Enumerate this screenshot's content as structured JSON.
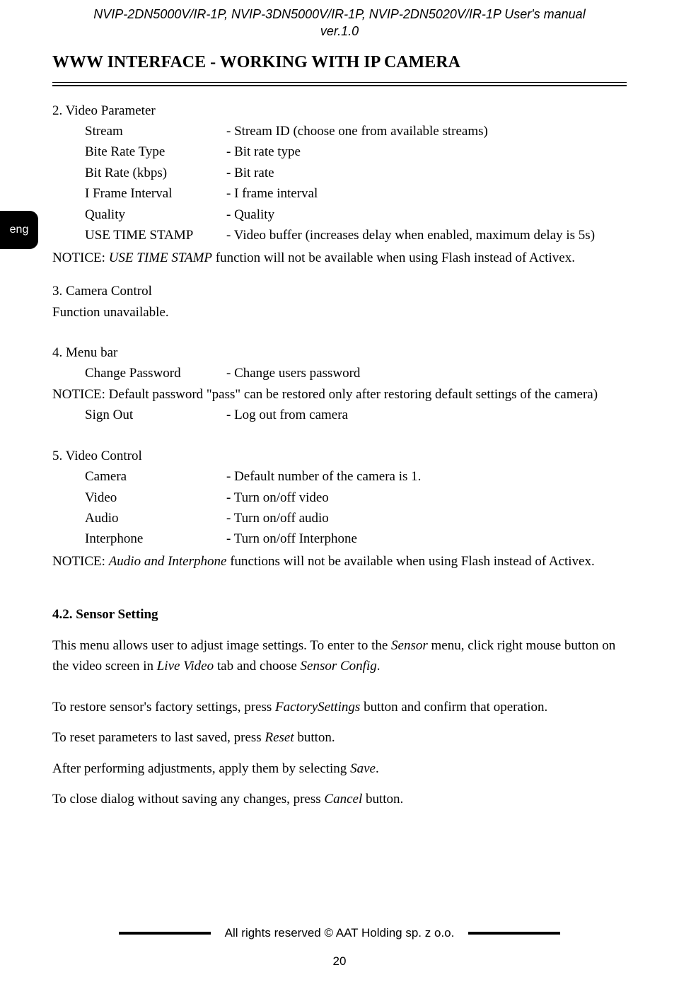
{
  "header": {
    "line1": "NVIP-2DN5000V/IR-1P, NVIP-3DN5000V/IR-1P, NVIP-2DN5020V/IR-1P User's manual",
    "line2": "ver.1.0"
  },
  "section_title": "WWW INTERFACE - WORKING WITH IP CAMERA",
  "lang_tab": "eng",
  "s2": {
    "heading": "2. Video Parameter",
    "rows": [
      {
        "term": "Stream",
        "desc": "- Stream ID (choose one from available streams)"
      },
      {
        "term": "Bite Rate Type",
        "desc": "- Bit rate type"
      },
      {
        "term": "Bit Rate (kbps)",
        "desc": "- Bit rate"
      },
      {
        "term": "I Frame Interval",
        "desc": "- I frame interval"
      },
      {
        "term": "Quality",
        "desc": "- Quality"
      },
      {
        "term": "USE TIME STAMP",
        "desc": "- Video buffer (increases delay when enabled, maximum delay is 5s)"
      }
    ],
    "notice_pre": "NOTICE: ",
    "notice_em": "USE TIME STAMP",
    "notice_post": " function will not be available when using Flash instead of Activex."
  },
  "s3": {
    "heading": "3. Camera Control",
    "text": "Function unavailable."
  },
  "s4": {
    "heading": "4. Menu bar",
    "row1": {
      "term": "Change Password",
      "desc": "- Change users password"
    },
    "notice": "NOTICE: Default password \"pass\" can be restored only after restoring default settings of the camera)",
    "row2": {
      "term": "Sign Out",
      "desc": "- Log out from camera"
    }
  },
  "s5": {
    "heading": "5. Video Control",
    "rows": [
      {
        "term": "Camera",
        "desc": "- Default number of the camera is 1."
      },
      {
        "term": "Video",
        "desc": "- Turn on/off video"
      },
      {
        "term": "Audio",
        "desc": "- Turn on/off audio"
      },
      {
        "term": "Interphone",
        "desc": "- Turn on/off Interphone"
      }
    ],
    "notice_pre": "NOTICE: ",
    "notice_em": "Audio and Interphone",
    "notice_post": " functions will not be available when using Flash instead of Activex."
  },
  "sec42": {
    "title": "4.2. Sensor Setting",
    "p1_a": "This menu allows user to adjust image settings. To enter to the ",
    "p1_em1": "Sensor",
    "p1_b": " menu, click right mouse button on the video screen in ",
    "p1_em2": "Live Video",
    "p1_c": " tab and choose ",
    "p1_em3": "Sensor Config",
    "p1_d": ".",
    "p2_a": "To restore sensor's factory settings, press ",
    "p2_em": "FactorySettings",
    "p2_b": " button and confirm that operation.",
    "p3_a": "To reset parameters to last saved, press ",
    "p3_em": "Reset",
    "p3_b": " button.",
    "p4_a": "After performing adjustments, apply them by selecting ",
    "p4_em": "Save",
    "p4_b": ".",
    "p5_a": "To close dialog without saving any changes, press ",
    "p5_em": "Cancel",
    "p5_b": " button."
  },
  "footer": "All rights reserved © AAT Holding sp. z o.o.",
  "page_number": "20"
}
